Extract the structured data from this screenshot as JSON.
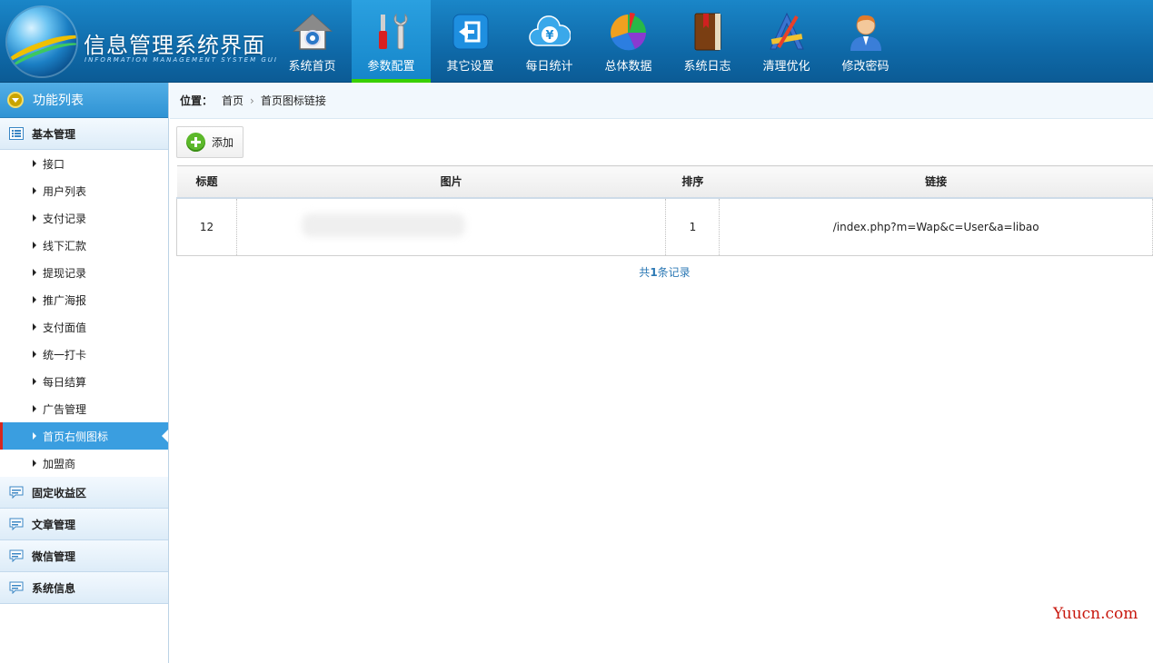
{
  "app": {
    "title": "信息管理系统界面",
    "subtitle": "INFORMATION MANAGEMENT SYSTEM GUI"
  },
  "nav": [
    {
      "label": "系统首页",
      "icon": "home-icon"
    },
    {
      "label": "参数配置",
      "icon": "tools-icon",
      "active": true
    },
    {
      "label": "其它设置",
      "icon": "exit-icon"
    },
    {
      "label": "每日统计",
      "icon": "yen-cloud-icon"
    },
    {
      "label": "总体数据",
      "icon": "pie-chart-icon"
    },
    {
      "label": "系统日志",
      "icon": "book-icon"
    },
    {
      "label": "清理优化",
      "icon": "ruler-pencil-icon"
    },
    {
      "label": "修改密码",
      "icon": "user-icon"
    }
  ],
  "sidebar": {
    "header": "功能列表",
    "groups": [
      {
        "label": "基本管理",
        "items": [
          "接口",
          "用户列表",
          "支付记录",
          "线下汇款",
          "提现记录",
          "推广海报",
          "支付面值",
          "统一打卡",
          "每日结算",
          "广告管理",
          "首页右侧图标",
          "加盟商"
        ],
        "active_index": 10
      },
      {
        "label": "固定收益区"
      },
      {
        "label": "文章管理"
      },
      {
        "label": "微信管理"
      },
      {
        "label": "系统信息"
      }
    ]
  },
  "breadcrumb": {
    "label": "位置：",
    "home": "首页",
    "current": "首页图标链接"
  },
  "toolbar": {
    "add_label": "添加"
  },
  "table": {
    "headers": [
      "标题",
      "图片",
      "排序",
      "链接"
    ],
    "rows": [
      {
        "title": "12",
        "image": "",
        "order": "1",
        "link": "/index.php?m=Wap&c=User&a=libao"
      }
    ]
  },
  "pager": {
    "prefix": "共",
    "count": "1",
    "suffix": "条记录"
  },
  "watermark": "Yuucn.com",
  "colors": {
    "header": "#0f6aa9",
    "active_nav": "#1585c9",
    "active_indicator": "#3ad000",
    "sidebar_active": "#3a9ee0",
    "link": "#2b78b4"
  }
}
